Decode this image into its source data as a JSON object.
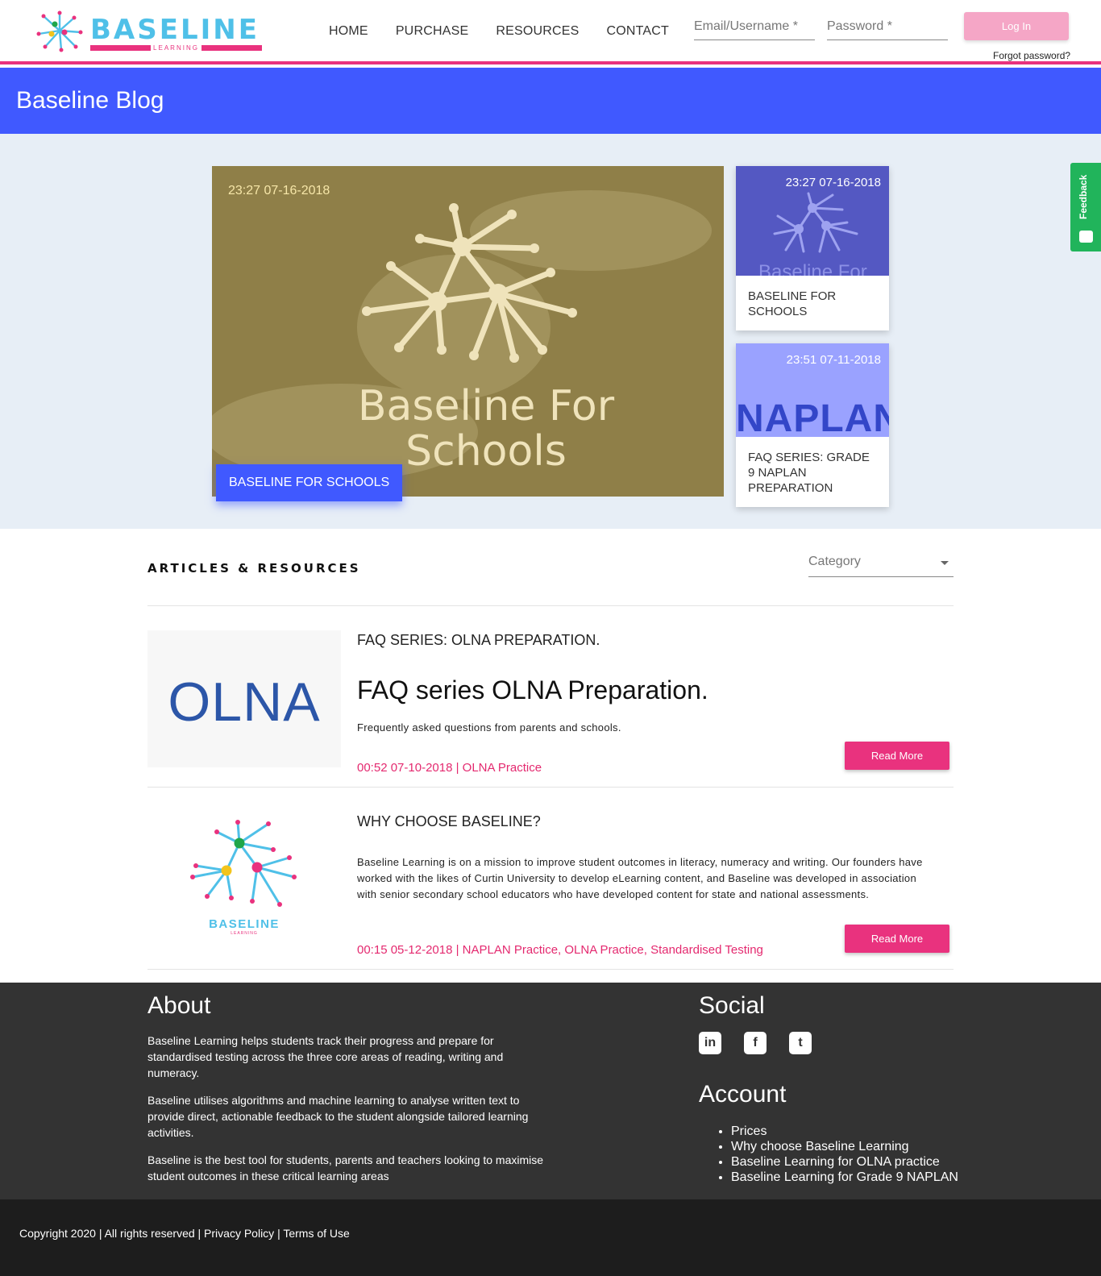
{
  "brand": {
    "name": "BASELINE",
    "sub": "LEARNING",
    "primary": "#4059ff",
    "accent": "#e9327e",
    "logo_color": "#4fc0e8"
  },
  "nav": {
    "items": [
      "HOME",
      "PURCHASE",
      "RESOURCES",
      "CONTACT"
    ]
  },
  "login": {
    "email_placeholder": "Email/Username *",
    "password_placeholder": "Password *",
    "button": "Log In",
    "forgot": "Forgot password?"
  },
  "banner": {
    "title": "Baseline Blog"
  },
  "featured": {
    "main": {
      "date": "23:27 07-16-2018",
      "image_text": "Baseline For Schools",
      "tag": "BASELINE FOR SCHOOLS"
    },
    "side": [
      {
        "date": "23:27 07-16-2018",
        "image_text": "Baseline For",
        "title": "BASELINE FOR SCHOOLS"
      },
      {
        "date": "23:51 07-11-2018",
        "image_text": "NAPLAN",
        "title": "FAQ SERIES: GRADE 9 NAPLAN PREPARATION"
      }
    ]
  },
  "feedback": {
    "label": "Feedback"
  },
  "articles": {
    "heading": "ARTICLES & RESOURCES",
    "category_placeholder": "Category",
    "items": [
      {
        "thumb_text": "OLNA",
        "category": "FAQ SERIES: OLNA PREPARATION.",
        "title": "FAQ series OLNA Preparation.",
        "desc": "Frequently asked questions from parents and schools.",
        "meta": "00:52 07-10-2018 | OLNA Practice",
        "button": "Read More"
      },
      {
        "thumb_text": "BASELINE",
        "thumb_sub": "LEARNING",
        "category": "WHY CHOOSE BASELINE?",
        "title": "",
        "desc": "Baseline Learning is on a mission to improve student outcomes in literacy, numeracy and writing. Our founders have worked with the likes of Curtin University to develop eLearning content, and Baseline was developed in association with senior secondary school educators who have developed content for state and national assessments.",
        "meta": "00:15 05-12-2018 | NAPLAN Practice, OLNA Practice, Standardised Testing",
        "button": "Read More"
      }
    ]
  },
  "footer": {
    "about": {
      "heading": "About",
      "paragraphs": [
        "Baseline Learning helps students track their progress and prepare for standardised testing across the three core areas of reading, writing and numeracy.",
        "Baseline utilises algorithms and machine learning to analyse written text to provide direct, actionable feedback to the student alongside tailored learning activities.",
        "Baseline is the best tool for students, parents and teachers looking to maximise student outcomes in these critical learning areas"
      ]
    },
    "social": {
      "heading": "Social",
      "icons": [
        "linkedin-icon",
        "facebook-icon",
        "twitter-icon"
      ],
      "glyphs": [
        "in",
        "f",
        "t"
      ]
    },
    "account": {
      "heading": "Account",
      "links": [
        "Prices",
        "Why choose Baseline Learning",
        "Baseline Learning for OLNA practice",
        "Baseline Learning for Grade 9 NAPLAN"
      ]
    },
    "copyright": "Copyright 2020 | All rights reserved | Privacy Policy | Terms of Use"
  }
}
